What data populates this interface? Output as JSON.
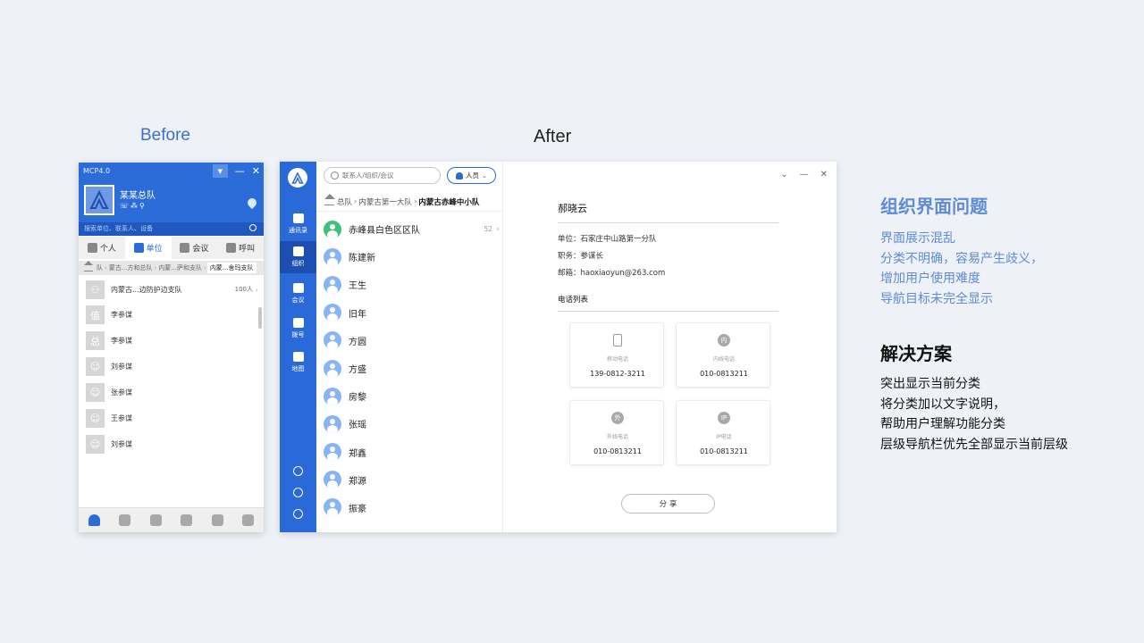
{
  "labels": {
    "before": "Before",
    "after": "After"
  },
  "old_ui": {
    "title": "MCP4.0",
    "org_name": "某某总队",
    "search_placeholder": "搜索单位、联系人、设备",
    "tabs": [
      {
        "label": "个人",
        "icon": "person-icon"
      },
      {
        "label": "单位",
        "icon": "org-icon",
        "active": true
      },
      {
        "label": "会议",
        "icon": "meeting-icon"
      },
      {
        "label": "呼叫",
        "icon": "phone-icon"
      }
    ],
    "breadcrumb": [
      "队",
      "蒙古...方和总队",
      "内蒙...萨和支队",
      "内蒙...舍玛支队"
    ],
    "group_row": {
      "name": "内蒙古...边防护边支队",
      "count": "100人"
    },
    "members": [
      {
        "name": "李参谋",
        "avatar_char": "值"
      },
      {
        "name": "李参谋",
        "avatar_char": "总"
      },
      {
        "name": "刘参谋",
        "avatar_char": ""
      },
      {
        "name": "张参谋",
        "avatar_char": ""
      },
      {
        "name": "王参谋",
        "avatar_char": ""
      },
      {
        "name": "刘参谋",
        "avatar_char": ""
      }
    ],
    "bottom_icons": [
      "person-icon",
      "alarm-icon",
      "megaphone-icon",
      "camera-icon",
      "broadcast-icon",
      "settings-icon"
    ]
  },
  "new_ui": {
    "rail": [
      {
        "label": "通讯录",
        "icon": "contacts-icon"
      },
      {
        "label": "组织",
        "icon": "org-icon",
        "active": true
      },
      {
        "label": "会议",
        "icon": "meeting-icon"
      },
      {
        "label": "拨号",
        "icon": "dial-icon"
      },
      {
        "label": "地图",
        "icon": "map-icon"
      }
    ],
    "search_placeholder": "联系人/组织/会议",
    "type_filter": "人员",
    "breadcrumb": [
      "总队",
      "内蒙古第一大队",
      "内蒙古赤峰中小队"
    ],
    "group_row": {
      "name": "赤峰县白色区区队",
      "count": "52"
    },
    "members": [
      "陈建新",
      "王生",
      "旧年",
      "方圆",
      "方盛",
      "房黎",
      "张瑶",
      "郑鑫",
      "郑源",
      "振豪"
    ],
    "detail": {
      "name": "郝晓云",
      "unit": "单位：石家庄中山路第一分队",
      "position": "职务：参谋长",
      "email": "邮箱：haoxiaoyun@263.com",
      "phone_list_title": "电话列表",
      "phones": [
        {
          "type": "移动电话",
          "number": "139-0812-3211",
          "icon_char": ""
        },
        {
          "type": "内线电话",
          "number": "010-0813211",
          "icon_char": "内"
        },
        {
          "type": "外线电话",
          "number": "010-0813211",
          "icon_char": "外"
        },
        {
          "type": "IP电话",
          "number": "010-0813211",
          "icon_char": "IP"
        }
      ],
      "share_label": "分 享"
    }
  },
  "notes": {
    "problem_title": "组织界面问题",
    "problems": [
      "界面展示混乱",
      "分类不明确，容易产生歧义，",
      "增加用户使用难度",
      "导航目标未完全显示"
    ],
    "solution_title": "解决方案",
    "solutions": [
      "突出显示当前分类",
      "将分类加以文字说明，",
      "帮助用户理解功能分类",
      "层级导航栏优先全部显示当前层级"
    ]
  }
}
